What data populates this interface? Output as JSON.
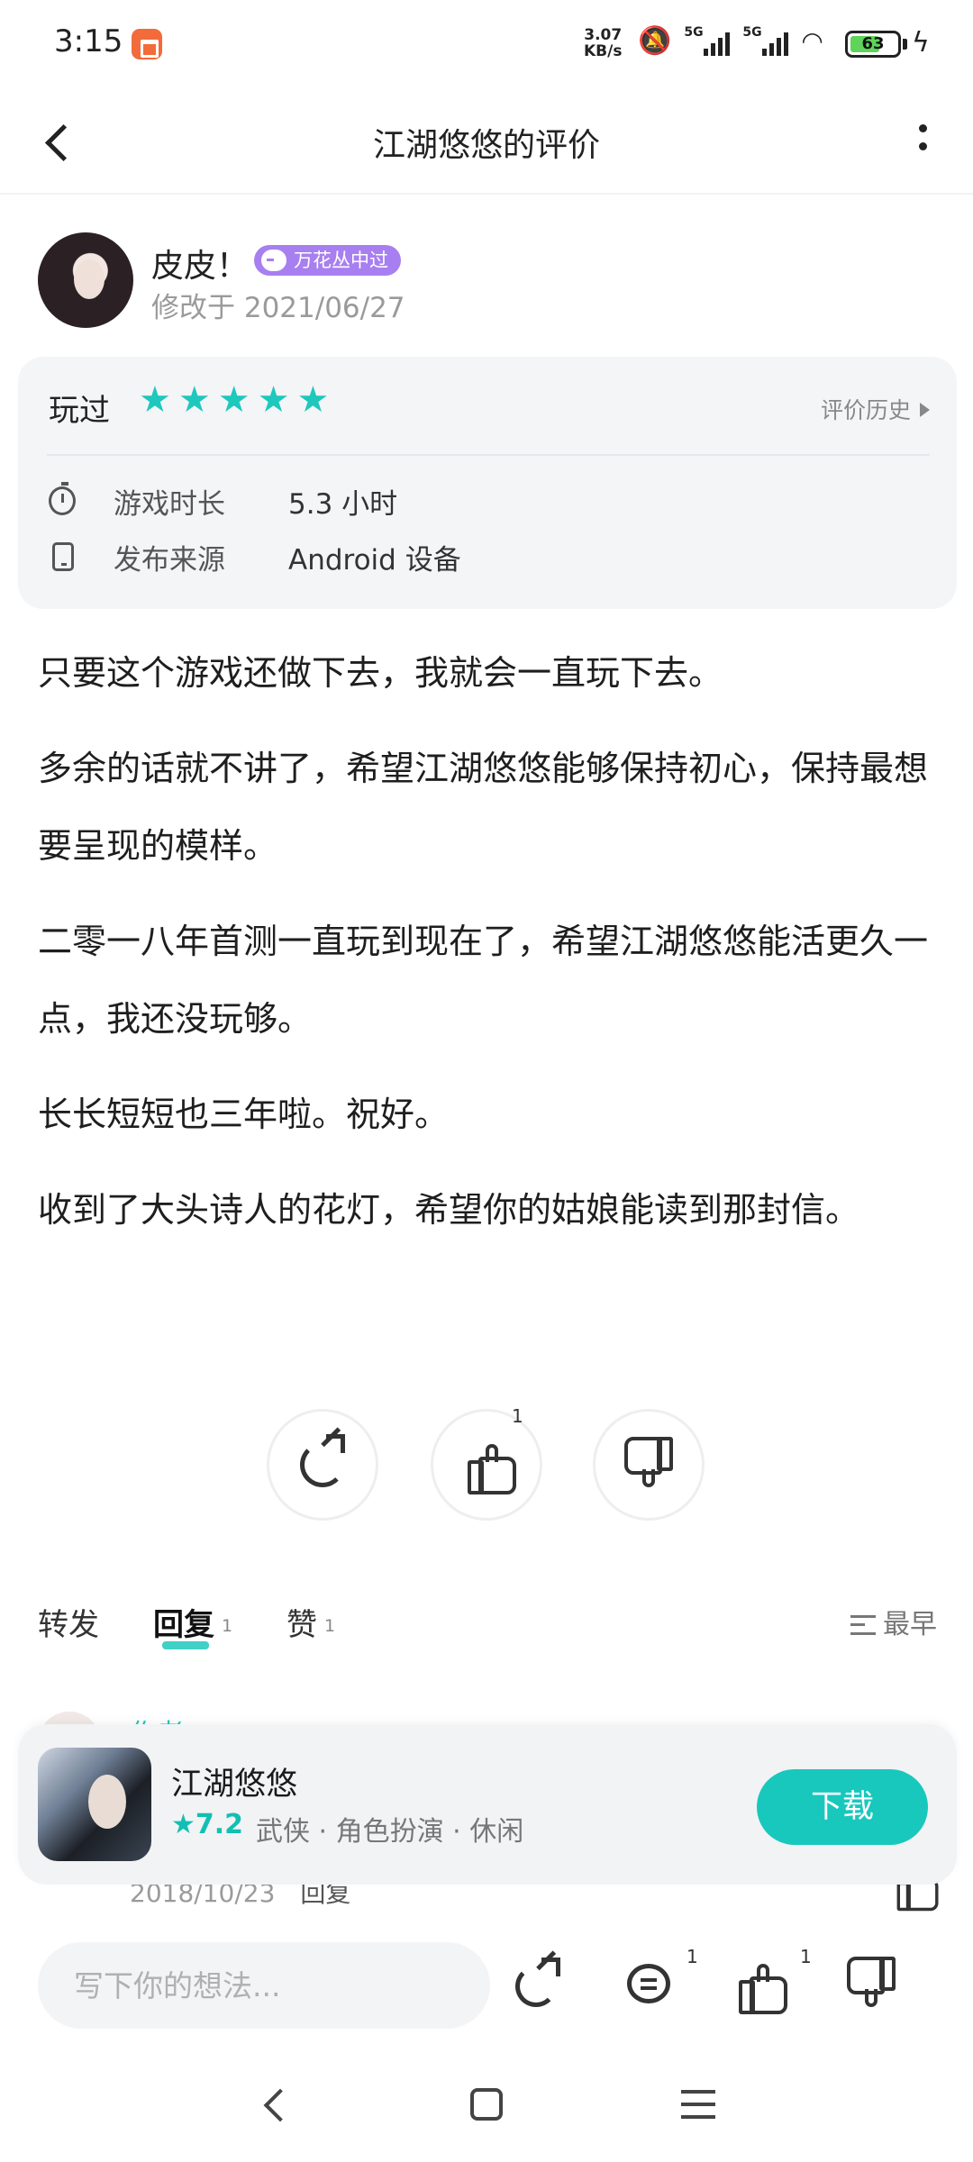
{
  "status": {
    "time": "3:15",
    "net_speed_value": "3.07",
    "net_speed_unit": "KB/s",
    "net1": "5G",
    "net2": "5G",
    "battery": "63",
    "battery_level": 63
  },
  "header": {
    "title": "江湖悠悠的评价"
  },
  "author": {
    "name": "皮皮！",
    "badge": "万花丛中过",
    "modified": "修改于 2021/06/27"
  },
  "card": {
    "played_label": "玩过",
    "stars": 5,
    "history_label": "评价历史",
    "playtime_label": "游戏时长",
    "playtime_value": "5.3 小时",
    "source_label": "发布来源",
    "source_value": "Android 设备"
  },
  "review": {
    "paragraphs": [
      "只要这个游戏还做下去，我就会一直玩下去。",
      "多余的话就不讲了，希望江湖悠悠能够保持初心，保持最想要呈现的模样。",
      "二零一八年首测一直玩到现在了，希望江湖悠悠能活更久一点，我还没玩够。",
      "长长短短也三年啦。祝好。",
      "收到了大头诗人的花灯，希望你的姑娘能读到那封信。"
    ]
  },
  "actions": {
    "like_count": "1"
  },
  "tabs": {
    "repost": "转发",
    "reply": "回复",
    "reply_count": "1",
    "like": "赞",
    "like_count": "1",
    "sort": "最早"
  },
  "reply": {
    "author": "作者",
    "date": "2018/10/23",
    "reply_label": "回复"
  },
  "game": {
    "name": "江湖悠悠",
    "rating": "★7.2",
    "tags": "武侠 · 角色扮演 · 休闲",
    "download": "下载"
  },
  "bottom": {
    "input_placeholder": "写下你的想法...",
    "comment_count": "1",
    "like_count": "1"
  }
}
